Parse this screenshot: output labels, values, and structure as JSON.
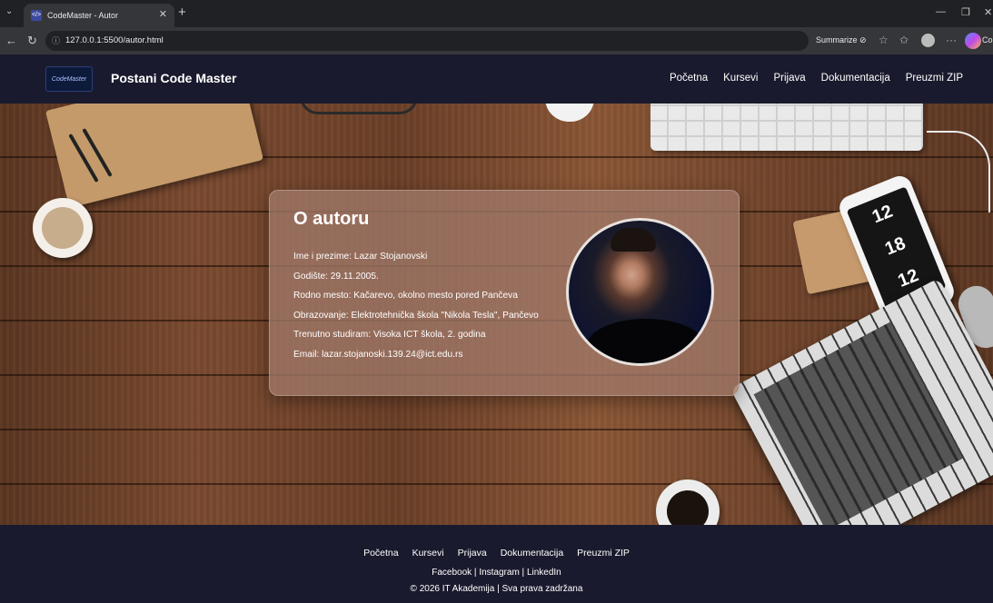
{
  "browser": {
    "tab_title": "CodeMaster - Autor",
    "favicon": "</>",
    "url": "127.0.0.1:5500/autor.html",
    "summarize_label": "Summarize",
    "copilot_label": "Co"
  },
  "header": {
    "logo_text": "CodeMaster",
    "brand": "Postani Code Master",
    "nav": [
      "Početna",
      "Kursevi",
      "Prijava",
      "Dokumentacija",
      "Preuzmi ZIP"
    ]
  },
  "card": {
    "title": "O autoru",
    "items": [
      "Ime i prezime: Lazar Stojanovski",
      "Godište: 29.11.2005.",
      "Rodno mesto: Kačarevo, okolno mesto pored Pančeva",
      "Obrazovanje: Elektrotehnička škola \"Nikola Tesla\", Pančevo",
      "Trenutno studiram: Visoka ICT škola, 2. godina",
      "Email: lazar.stojanoski.139.24@ict.edu.rs"
    ]
  },
  "hero": {
    "phone_digits": [
      "12",
      "18",
      "12"
    ]
  },
  "footer": {
    "nav": [
      "Početna",
      "Kursevi",
      "Prijava",
      "Dokumentacija",
      "Preuzmi ZIP"
    ],
    "social": [
      "Facebook",
      "Instagram",
      "LinkedIn"
    ],
    "copyright": "© 2026 IT Akademija | Sva prava zadržana"
  },
  "colors": {
    "header_bg": "#1a1a2e",
    "card_bg": "#a07869"
  }
}
